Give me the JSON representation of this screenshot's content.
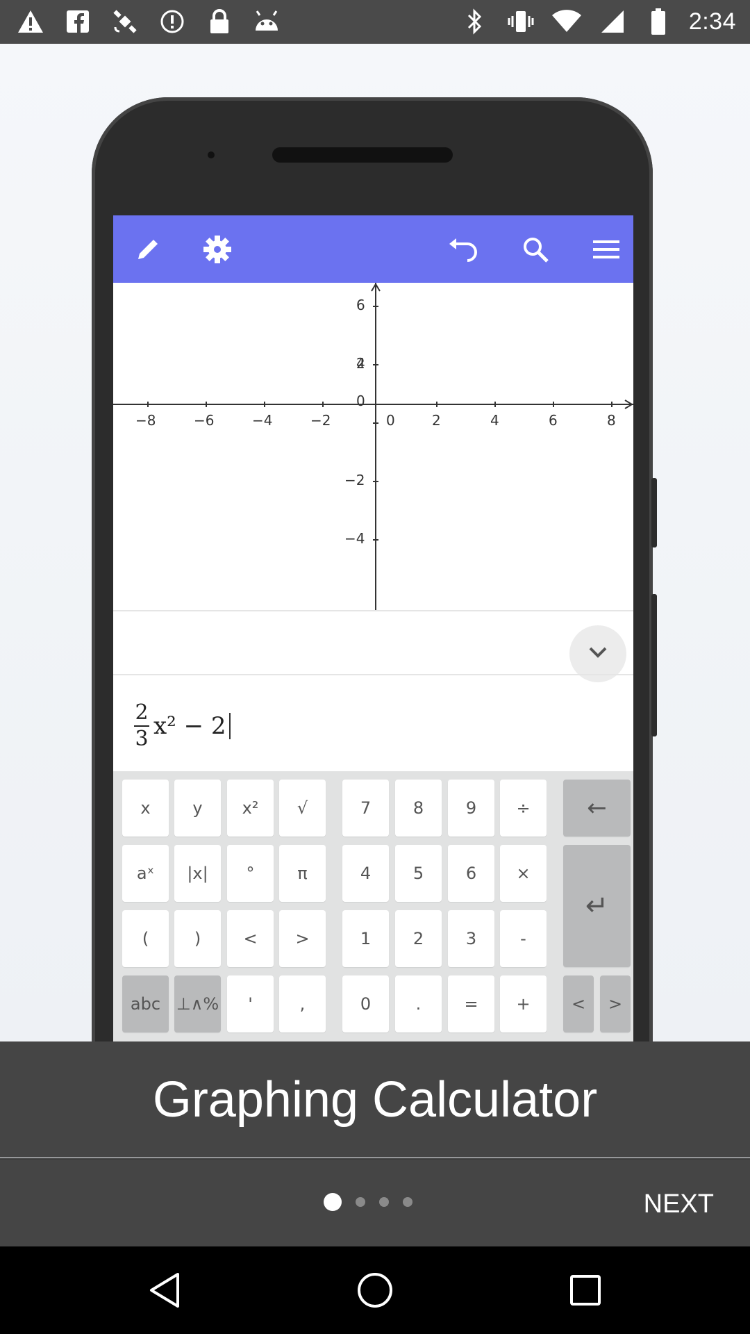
{
  "status_bar": {
    "time": "2:34",
    "left_icons": [
      "warning-icon",
      "facebook-icon",
      "satellite-icon",
      "info-circle-icon",
      "lock-icon",
      "android-icon"
    ],
    "right_icons": [
      "bluetooth-icon",
      "vibrate-icon",
      "wifi-icon",
      "signal-icon",
      "battery-icon"
    ]
  },
  "app_preview": {
    "toolbar": {
      "color": "#6b72f0",
      "left_icons": [
        "pencil-icon",
        "gear-icon"
      ],
      "right_icons": [
        "undo-icon",
        "search-icon",
        "menu-icon"
      ]
    },
    "graph": {
      "x_ticks": [
        "−8",
        "−6",
        "−4",
        "−2",
        "0",
        "2",
        "4",
        "6",
        "8"
      ],
      "y_ticks_pos": [
        "6",
        "4",
        "2",
        "0"
      ],
      "y_ticks_neg": [
        "−2",
        "−4"
      ]
    },
    "expression": {
      "numerator": "2",
      "denominator": "3",
      "rest": "x² − 2"
    },
    "keyboard": {
      "left_rows": [
        [
          "x",
          "y",
          "x²",
          "√"
        ],
        [
          "aˣ",
          "|x|",
          "°",
          "π"
        ],
        [
          "(",
          ")",
          "<",
          ">"
        ],
        [
          "abc",
          "⊥∧%",
          "'",
          ","
        ]
      ],
      "num_rows": [
        [
          "7",
          "8",
          "9",
          "÷"
        ],
        [
          "4",
          "5",
          "6",
          "×"
        ],
        [
          "1",
          "2",
          "3",
          "-"
        ],
        [
          "0",
          ".",
          "=",
          "+"
        ]
      ],
      "backspace": "←",
      "enter": "↵",
      "left_arrow": "<",
      "right_arrow": ">"
    }
  },
  "onboarding": {
    "title": "Graphing Calculator",
    "page_count": 4,
    "active_page": 1,
    "next_label": "NEXT"
  },
  "system_nav": [
    "back-icon",
    "home-icon",
    "recents-icon"
  ]
}
